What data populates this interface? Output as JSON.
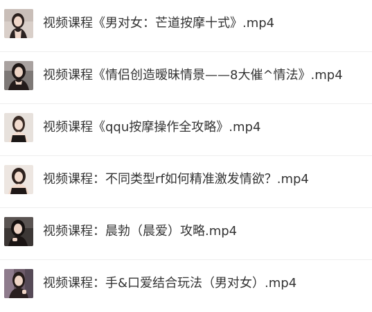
{
  "files": [
    {
      "name": "视频课程《男对女：芒道按摩十式》.mp4",
      "thumbnail": "video-thumbnail-icon"
    },
    {
      "name": "视频课程《情侣创造暧昧情景——8大催^情法》.mp4",
      "thumbnail": "video-thumbnail-icon"
    },
    {
      "name": "视频课程《qqu按摩操作全攻略》.mp4",
      "thumbnail": "video-thumbnail-icon"
    },
    {
      "name": "视频课程：不同类型rf如何精准激发情欲？.mp4",
      "thumbnail": "video-thumbnail-icon"
    },
    {
      "name": "视频课程：晨勃（晨爱）攻略.mp4",
      "thumbnail": "video-thumbnail-icon"
    },
    {
      "name": "视频课程：手&口爱结合玩法（男对女）.mp4",
      "thumbnail": "video-thumbnail-icon"
    }
  ],
  "colors": {
    "text": "#333333",
    "divider": "#eeeeee",
    "background": "#ffffff"
  }
}
